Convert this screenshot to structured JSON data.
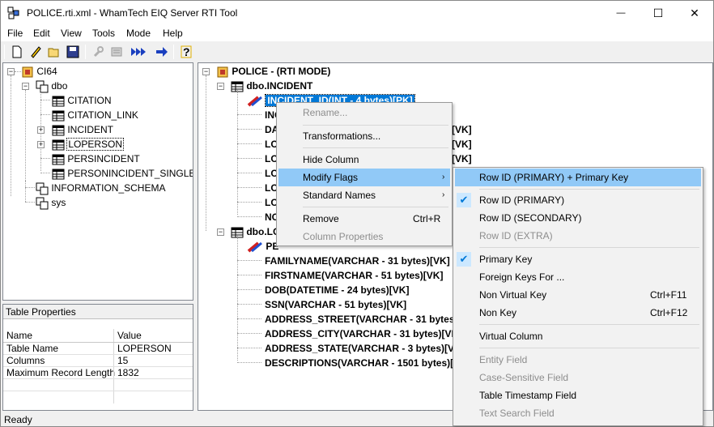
{
  "window": {
    "title": "POLICE.rti.xml - WhamTech EIQ Server RTI Tool",
    "minimize": "—",
    "maximize": "☐",
    "close": "✕"
  },
  "menubar": [
    "File",
    "Edit",
    "View",
    "Tools",
    "Mode",
    "Help"
  ],
  "toolbar": {
    "icons": [
      "new-icon",
      "edit-icon",
      "open-icon",
      "save-icon",
      "wrench-icon",
      "config-icon",
      "run-all-icon",
      "go-arrow-icon",
      "help-icon"
    ]
  },
  "left_tree": {
    "root": "CI64",
    "schema": "dbo",
    "tables": [
      "CITATION",
      "CITATION_LINK",
      "INCIDENT",
      "LOPERSON",
      "PERSINCIDENT",
      "PERSONINCIDENT_SINGLE"
    ],
    "schemas_other": [
      "INFORMATION_SCHEMA",
      "sys"
    ]
  },
  "right_tree": {
    "root": "POLICE  - (RTI MODE)",
    "table1": "dbo.INCIDENT",
    "table1_cols": [
      "INCIDENT_ID(INT - 4 bytes)[PK]",
      "INC",
      "DA",
      "LO",
      "LO",
      "LO",
      "LO",
      "LO",
      "NO"
    ],
    "table1_cols_tail": [
      "",
      "",
      "[VK]",
      "[VK]",
      "[VK]",
      "",
      "",
      "",
      ""
    ],
    "table2": "dbo.LO",
    "table2_cols": [
      "PE",
      "FAMILYNAME(VARCHAR - 31 bytes)[VK]",
      "FIRSTNAME(VARCHAR - 51 bytes)[VK]",
      "DOB(DATETIME - 24 bytes)[VK]",
      "SSN(VARCHAR - 51 bytes)[VK]",
      "ADDRESS_STREET(VARCHAR - 31 bytes)[V",
      "ADDRESS_CITY(VARCHAR - 31 bytes)[VK]",
      "ADDRESS_STATE(VARCHAR - 3 bytes)[VK]",
      "DESCRIPTIONS(VARCHAR - 1501 bytes)[VK]"
    ]
  },
  "properties": {
    "title": "Table Properties",
    "headers": [
      "Name",
      "Value"
    ],
    "rows": [
      [
        "Table Name",
        "LOPERSON"
      ],
      [
        "Columns",
        "15"
      ],
      [
        "Maximum Record Length",
        "1832"
      ]
    ]
  },
  "status": "Ready",
  "context_menu": {
    "items": [
      {
        "label": "Rename...",
        "enabled": false
      },
      {
        "label": "Transformations...",
        "enabled": true
      },
      {
        "label": "Hide Column",
        "enabled": true
      },
      {
        "label": "Modify Flags",
        "enabled": true,
        "submenu": true,
        "highlighted": true
      },
      {
        "label": "Standard Names",
        "enabled": true,
        "submenu": true
      },
      {
        "label": "Remove",
        "enabled": true,
        "shortcut": "Ctrl+R"
      },
      {
        "label": "Column Properties",
        "enabled": false
      }
    ]
  },
  "flags_menu": {
    "items": [
      {
        "label": "Row ID (PRIMARY) + Primary Key",
        "highlighted": true
      },
      {
        "label": "Row ID (PRIMARY)",
        "checked": true
      },
      {
        "label": "Row ID (SECONDARY)"
      },
      {
        "label": "Row ID (EXTRA)",
        "enabled": false
      },
      {
        "label": "Primary Key",
        "checked": true
      },
      {
        "label": "Foreign Keys For ..."
      },
      {
        "label": "Non Virtual Key",
        "shortcut": "Ctrl+F11"
      },
      {
        "label": "Non Key",
        "shortcut": "Ctrl+F12"
      },
      {
        "label": "Virtual Column"
      },
      {
        "label": "Entity Field",
        "enabled": false
      },
      {
        "label": "Case-Sensitive Field",
        "enabled": false
      },
      {
        "label": "Table Timestamp Field"
      },
      {
        "label": "Text Search Field",
        "enabled": false
      }
    ],
    "check_glyph": "✔"
  },
  "colors": {
    "selection": "#0078d7",
    "menu_highlight": "#91c9f7",
    "disabled": "#8d8d8d"
  }
}
